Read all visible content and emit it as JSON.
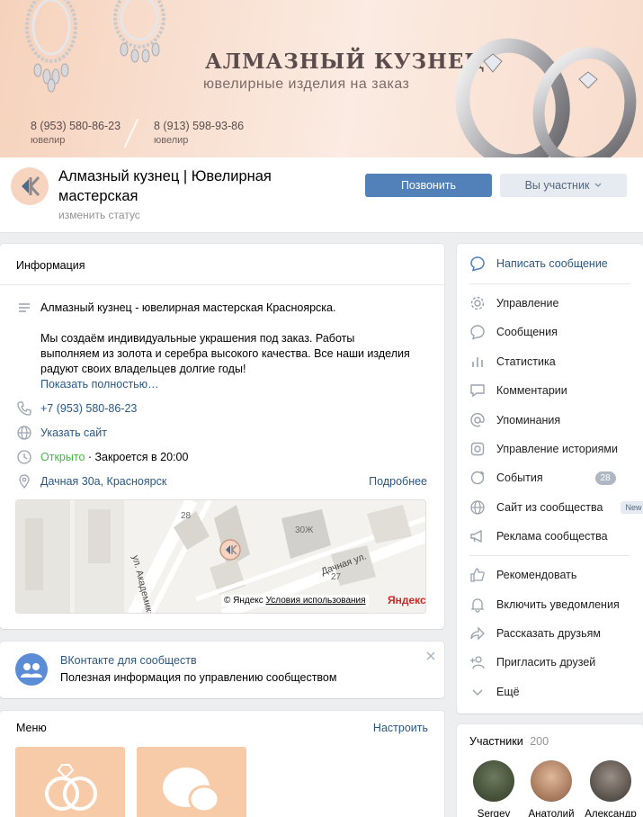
{
  "cover": {
    "title": "АЛМАЗНЫЙ КУЗНЕЦ",
    "subtitle": "ювелирные изделия на заказ",
    "phone1": "8 (953) 580-86-23",
    "role1": "ювелир",
    "phone2": "8 (913) 598-93-86",
    "role2": "ювелир"
  },
  "header": {
    "title": "Алмазный кузнец | Ювелирная мастерская",
    "status_link": "изменить статус",
    "call_button": "Позвонить",
    "member_button": "Вы участник"
  },
  "info": {
    "title": "Информация",
    "description_line1": "Алмазный кузнец - ювелирная мастерская Красноярска.",
    "description_line2": "Мы создаём индивидуальные украшения под заказ. Работы",
    "description_line3": "выполняем из золота и серебра высокого качества. Все наши изделия",
    "description_line4": "радуют своих владельцев долгие годы!",
    "show_more": "Показать полностью…",
    "phone": "+7 (953) 580-86-23",
    "website": "Указать сайт",
    "open_status": "Открыто",
    "closes": "· Закроется в 20:00",
    "address": "Дачная 30а, Красноярск",
    "more_link": "Подробнее",
    "map": {
      "street1": "ул. Академика Кир...",
      "street2": "Дачная ул.",
      "house1": "28",
      "house2": "30Ж",
      "house3": "27",
      "copyright": "© Яндекс",
      "terms": "Условия использования",
      "brand": "Яндекс"
    }
  },
  "vk_promo": {
    "title": "ВКонтакте для сообществ",
    "text": "Полезная информация по управлению сообществом"
  },
  "menu": {
    "title": "Меню",
    "configure": "Настроить"
  },
  "side": {
    "items": [
      {
        "label": "Написать сообщение",
        "icon": "message-icon"
      },
      {
        "label": "Управление",
        "icon": "gear-icon"
      },
      {
        "label": "Сообщения",
        "icon": "chat-icon"
      },
      {
        "label": "Статистика",
        "icon": "stats-icon"
      },
      {
        "label": "Комментарии",
        "icon": "comments-icon"
      },
      {
        "label": "Упоминания",
        "icon": "at-icon"
      },
      {
        "label": "Управление историями",
        "icon": "stories-icon"
      },
      {
        "label": "События",
        "icon": "events-icon",
        "badge": "28"
      },
      {
        "label": "Сайт из сообщества",
        "icon": "globe-icon",
        "badge": "New"
      },
      {
        "label": "Реклама сообщества",
        "icon": "megaphone-icon"
      },
      {
        "label": "Рекомендовать",
        "icon": "thumbs-up-icon"
      },
      {
        "label": "Включить уведомления",
        "icon": "bell-icon"
      },
      {
        "label": "Рассказать друзьям",
        "icon": "share-icon"
      },
      {
        "label": "Пригласить друзей",
        "icon": "add-user-icon"
      },
      {
        "label": "Ещё",
        "icon": "chevron-down-icon"
      }
    ]
  },
  "members": {
    "title": "Участники",
    "count": "200",
    "list": [
      "Sergey",
      "Анатолий",
      "Александр"
    ]
  },
  "colors": {
    "accent": "#5181b8",
    "link": "#2a5885",
    "open": "#4bb34b",
    "cover_peach": "#f6d2bc"
  }
}
